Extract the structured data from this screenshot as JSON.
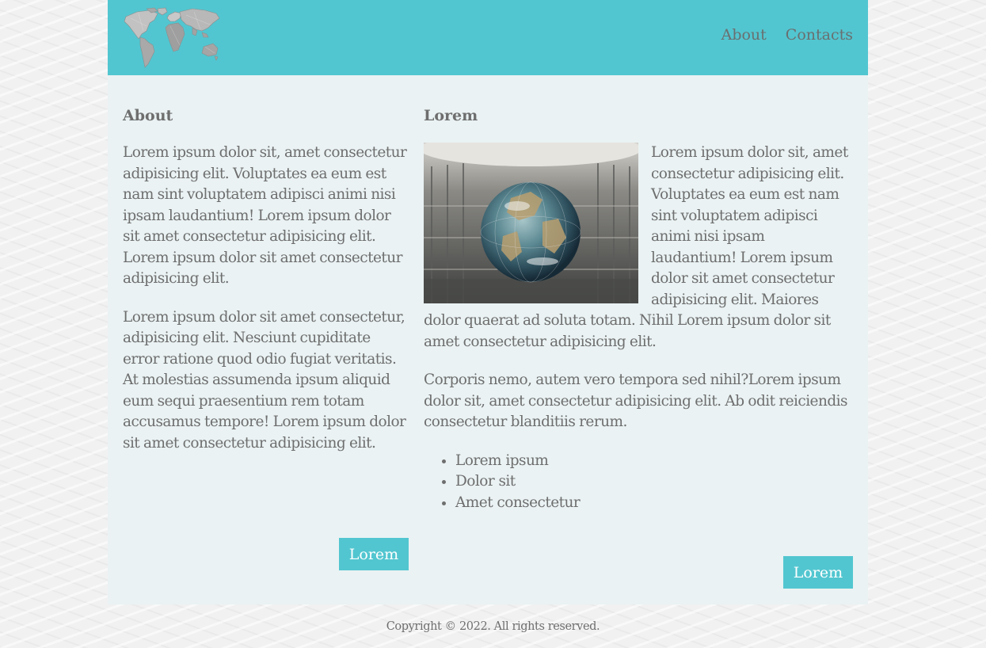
{
  "header": {
    "logo_icon": "world-map-icon",
    "nav": [
      {
        "label": "About"
      },
      {
        "label": "Contacts"
      }
    ],
    "accent": "#52c6d0"
  },
  "about": {
    "title": "About",
    "paragraphs": [
      "Lorem ipsum dolor sit, amet consectetur adipisicing elit. Voluptates ea eum est nam sint voluptatem adipisci animi nisi ipsam laudantium! Lorem ipsum dolor sit amet consectetur adipisicing elit. Lorem ipsum dolor sit amet consectetur adipisicing elit.",
      "Lorem ipsum dolor sit amet consectetur, adipisicing elit. Nesciunt cupiditate error ratione quod odio fugiat veritatis. At molestias assumenda ipsum aliquid eum sequi praesentium rem totam accusamus tempore! Lorem ipsum dolor sit amet consectetur adipisicing elit."
    ],
    "button_label": "Lorem"
  },
  "lorem": {
    "title": "Lorem",
    "image_icon": "globe-photo",
    "paragraphs": [
      "Lorem ipsum dolor sit, amet consectetur adipisicing elit. Voluptates ea eum est nam sint voluptatem adipisci animi nisi ipsam laudantium! Lorem ipsum dolor sit amet consectetur adipisicing elit. Maiores dolor quaerat ad soluta totam. Nihil Lorem ipsum dolor sit amet consectetur adipisicing elit.",
      "Corporis nemo, autem vero tempora sed nihil?Lorem ipsum dolor sit, amet consectetur adipisicing elit. Ab odit reiciendis consectetur blanditiis rerum."
    ],
    "list": [
      "Lorem ipsum",
      "Dolor sit",
      "Amet consectetur"
    ],
    "button_label": "Lorem"
  },
  "footer": {
    "copyright": "Copyright © 2022. All rights reserved."
  }
}
